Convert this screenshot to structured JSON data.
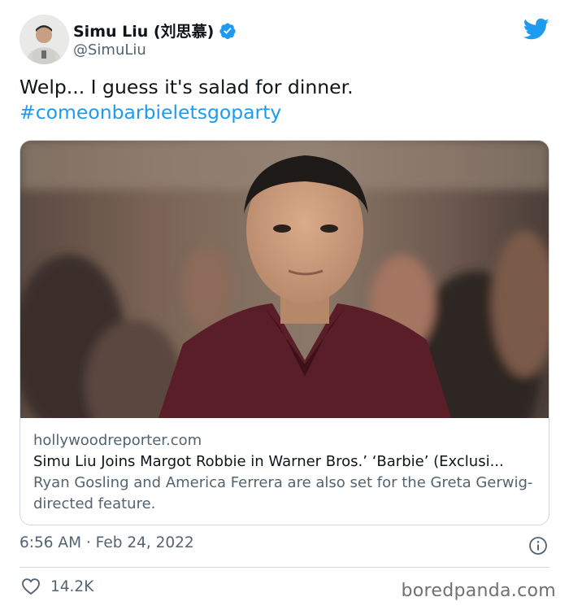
{
  "tweet": {
    "author_name": "Simu Liu (刘思慕)",
    "handle": "@SimuLiu",
    "text": "Welp... I guess it's salad for dinner.",
    "hashtag": "#comeonbarbieletsgoparty",
    "timestamp": "6:56 AM · Feb 24, 2022",
    "likes": "14.2K"
  },
  "card": {
    "domain": "hollywoodreporter.com",
    "title": "Simu Liu Joins Margot Robbie in Warner Bros.’ ‘Barbie’ (Exclusi...",
    "description": "Ryan Gosling and America Ferrera are also set for the Greta Gerwig-directed feature."
  },
  "watermark": "boredpanda.com",
  "icons": {
    "verified": "verified-badge-icon",
    "platform": "twitter-bird-icon",
    "info": "info-icon",
    "like": "heart-icon"
  },
  "colors": {
    "accent": "#1d9bf0",
    "text": "#0f1419",
    "muted": "#536471",
    "border": "#cfd9de"
  }
}
